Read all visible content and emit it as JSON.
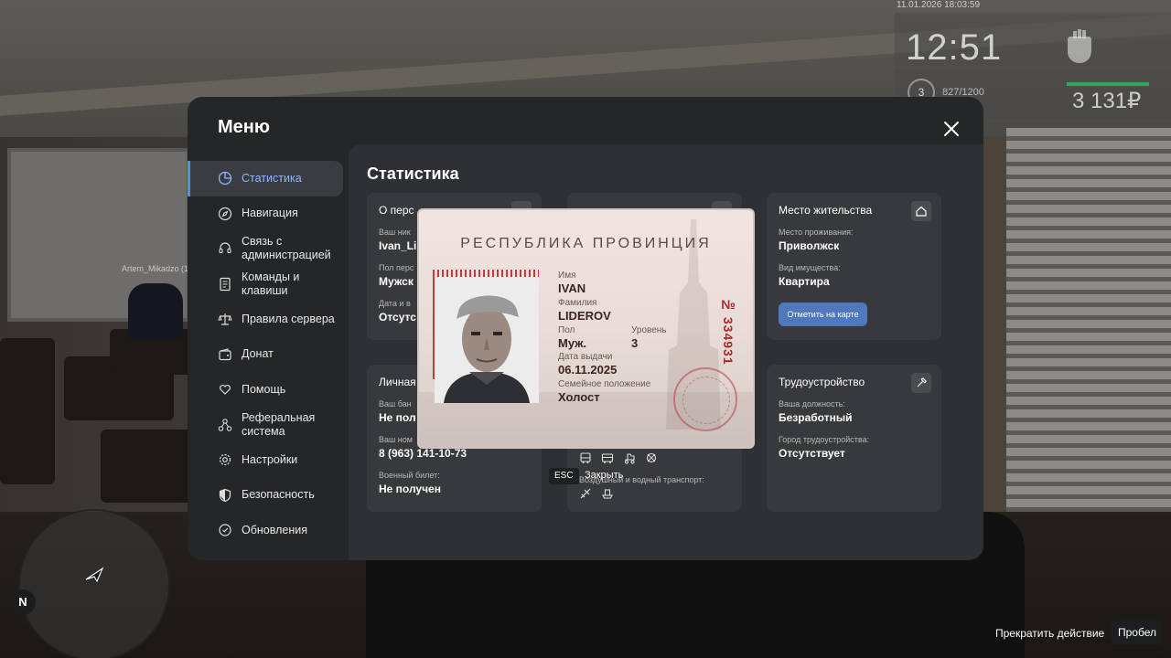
{
  "hud": {
    "datetime": "11.01.2026 18:03:59",
    "time": "12:51",
    "level": "3",
    "xp": "827/1200",
    "money": "3 131₽",
    "hp_color": "#2fa65a",
    "fist_icon": "fist-icon"
  },
  "player_tag": "Artem_Mikadzo (1",
  "menu": {
    "title": "Меню",
    "sidebar": [
      {
        "label": "Статистика",
        "icon": "pie-chart-icon",
        "active": true
      },
      {
        "label": "Навигация",
        "icon": "compass-icon"
      },
      {
        "label": "Связь с администрацией",
        "icon": "headset-icon"
      },
      {
        "label": "Команды и клавиши",
        "icon": "document-icon"
      },
      {
        "label": "Правила сервера",
        "icon": "scales-icon"
      },
      {
        "label": "Донат",
        "icon": "wallet-icon"
      },
      {
        "label": "Помощь",
        "icon": "heart-hands-icon"
      },
      {
        "label": "Реферальная система",
        "icon": "network-icon"
      },
      {
        "label": "Настройки",
        "icon": "gear-icon"
      },
      {
        "label": "Безопасность",
        "icon": "shield-icon"
      },
      {
        "label": "Обновления",
        "icon": "refresh-icon"
      }
    ],
    "content_title": "Статистика",
    "cards": {
      "personal": {
        "title": "О перс",
        "nick_label": "Ваш ник",
        "nick_value": "Ivan_Li",
        "gender_label": "Пол перс",
        "gender_value": "Мужск",
        "date_label": "Дата и в",
        "date_value": "Отсутс"
      },
      "residence": {
        "title": "Место жительства",
        "place_label": "Место проживания:",
        "place_value": "Приволжск",
        "property_label": "Вид имущества:",
        "property_value": "Квартира",
        "map_button": "Отметить на карте"
      },
      "private": {
        "title": "Личная",
        "bank_label": "Ваш бан",
        "bank_value": "Не пол",
        "phone_label": "Ваш ном",
        "phone_value": "8 (963) 141-10-73",
        "military_label": "Военный билет:",
        "military_value": "Не получен"
      },
      "transport": {
        "air_label": "Воздушный и водный транспорт:"
      },
      "employment": {
        "title": "Трудоустройство",
        "position_label": "Ваша должность:",
        "position_value": "Безработный",
        "city_label": "Город трудоустройства:",
        "city_value": "Отсутствует"
      }
    }
  },
  "passport": {
    "title": "РЕСПУБЛИКА ПРОВИНЦИЯ",
    "number": "№ 334931",
    "name_label": "Имя",
    "name_value": "IVAN",
    "surname_label": "Фамилия",
    "surname_value": "LIDEROV",
    "gender_label": "Пол",
    "gender_value": "Муж.",
    "level_label": "Уровень",
    "level_value": "3",
    "issue_label": "Дата выдачи",
    "issue_value": "06.11.2025",
    "family_label": "Семейное положение",
    "family_value": "Холост"
  },
  "esc": {
    "key": "ESC",
    "label": "Закрыть"
  },
  "bottom": {
    "hint": "Прекратить действие",
    "key": "Пробел"
  },
  "minimap": {
    "north": "N"
  }
}
